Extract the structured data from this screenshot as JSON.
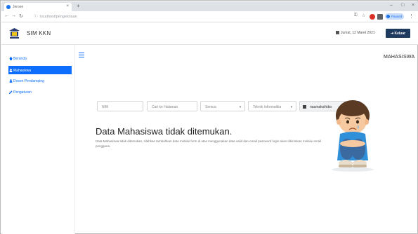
{
  "browser": {
    "tab_title": "Jeroen",
    "url": "localhost/pengelolaan",
    "profile_label": "Paused"
  },
  "header": {
    "brand": "SIM KKN",
    "date": "Jumat, 12 Maret 2021",
    "logout_label": "Keluar"
  },
  "sidebar": {
    "items": [
      {
        "label": "Beranda",
        "icon": "home-icon"
      },
      {
        "label": "Mahasiswa",
        "icon": "users-icon",
        "active": true
      },
      {
        "label": "Dosen Pendamping",
        "icon": "teacher-icon"
      },
      {
        "label": "Pengaturan",
        "icon": "pencil-icon"
      }
    ]
  },
  "page": {
    "title": "MAHASISWA"
  },
  "filters": {
    "nim_placeholder": "NIM",
    "search_placeholder": "Cari ke Halaman",
    "gender_value": "Semua",
    "prodi_value": "Teknik Informatika",
    "account_value": "naamaksihtbo"
  },
  "empty_state": {
    "title": "Data Mahasiswa tidak ditemukan.",
    "description": "Data Mahasiswa tidak ditemukan, silahkan tambahkan data melalui form di atas menggunakan data valid dan email password login akan dikirimkan melalui email pengguna."
  },
  "colors": {
    "accent": "#0d6efd",
    "logout_bg": "#1e3a5f"
  }
}
